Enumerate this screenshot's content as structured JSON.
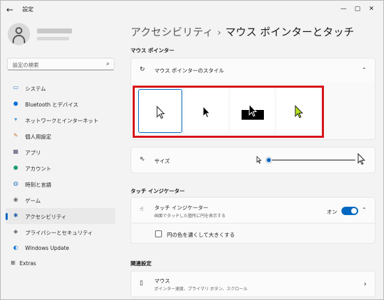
{
  "window": {
    "title": "設定",
    "minimize_icon": "minimize-icon",
    "maximize_icon": "maximize-icon",
    "close_icon": "close-icon"
  },
  "sidebar": {
    "search_placeholder": "設定の検索",
    "items": [
      {
        "label": "システム",
        "icon": "system-icon"
      },
      {
        "label": "Bluetooth とデバイス",
        "icon": "bluetooth-icon"
      },
      {
        "label": "ネットワークとインターネット",
        "icon": "network-icon"
      },
      {
        "label": "個人用設定",
        "icon": "personalization-icon"
      },
      {
        "label": "アプリ",
        "icon": "apps-icon"
      },
      {
        "label": "アカウント",
        "icon": "account-icon"
      },
      {
        "label": "時刻と言語",
        "icon": "time-language-icon"
      },
      {
        "label": "ゲーム",
        "icon": "gaming-icon"
      },
      {
        "label": "アクセシビリティ",
        "icon": "accessibility-icon",
        "active": true
      },
      {
        "label": "プライバシーとセキュリティ",
        "icon": "privacy-icon"
      },
      {
        "label": "Windows Update",
        "icon": "windows-update-icon"
      }
    ],
    "extras_label": "Extras"
  },
  "header": {
    "breadcrumb_parent": "アクセシビリティ",
    "breadcrumb_separator": "›",
    "breadcrumb_current": "マウス ポインターとタッチ"
  },
  "mouse_pointer_section": {
    "heading": "マウス ポインター",
    "style_card_title": "マウス ポインターのスタイル",
    "style_options": [
      "white",
      "black",
      "inverted",
      "custom"
    ],
    "selected_style": "white",
    "custom_color": "#b7e21a",
    "size_label": "サイズ",
    "size_value": 0.0
  },
  "touch_section": {
    "heading": "タッチ インジケーター",
    "indicator_title": "タッチ インジケーター",
    "indicator_desc": "画面でタッチした箇所に円を表示する",
    "toggle_label": "オン",
    "toggle_on": true,
    "darker_circle_label": "円の色を濃くして大きくする",
    "darker_circle_checked": false
  },
  "related_section": {
    "heading": "関連設定",
    "mouse_title": "マウス",
    "mouse_desc": "ポインター速度、プライマリ ボタン、スクロール"
  },
  "colors": {
    "accent": "#0067c0",
    "highlight_border": "#d7141a"
  }
}
